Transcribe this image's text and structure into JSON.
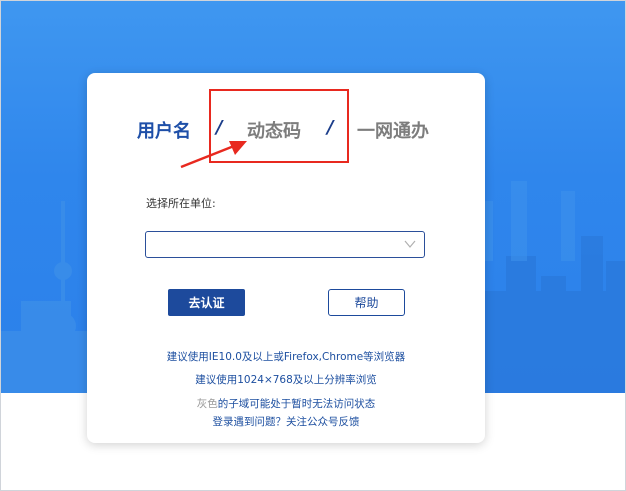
{
  "tabs": {
    "user": "用户名",
    "sep1": "/",
    "dynamic": "动态码",
    "sep2": "/",
    "web": "一网通办"
  },
  "form": {
    "unit_label": "选择所在单位:",
    "select_value": ""
  },
  "buttons": {
    "auth": "去认证",
    "help": "帮助"
  },
  "notes": {
    "browser": "建议使用IE10.0及以上或Firefox,Chrome等浏览器",
    "resolution": "建议使用1024×768及以上分辨率浏览",
    "gray_word": "灰色",
    "gray_rest": "的子域可能处于暂时无法访问状态",
    "help_link": "登录遇到问题？关注公众号反馈"
  },
  "colors": {
    "background": "#2f86ec",
    "primary": "#1d4a9c",
    "highlight": "#e8291f"
  }
}
